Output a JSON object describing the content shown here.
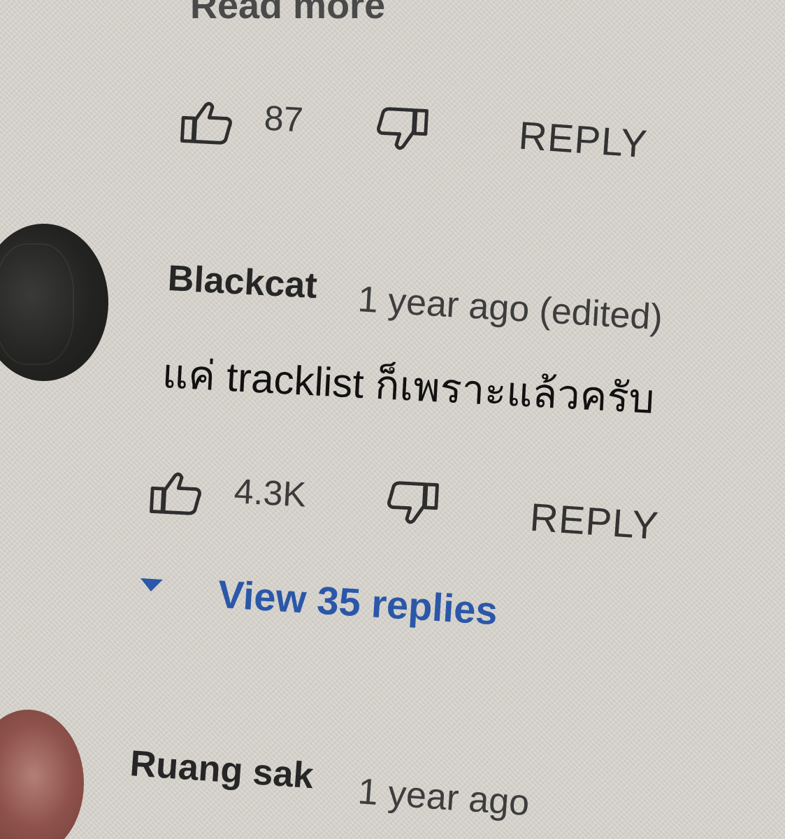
{
  "previous_comment": {
    "read_more_label": "Read more",
    "like_count": "87",
    "reply_label": "REPLY"
  },
  "comments": [
    {
      "author": "Blackcat",
      "time": "1 year ago (edited)",
      "text": "แค่ tracklist ก็เพราะแล้วครับ",
      "like_count": "4.3K",
      "reply_label": "REPLY",
      "view_replies_label": "View 35 replies"
    },
    {
      "author": "Ruang sak",
      "time": "1 year ago"
    }
  ],
  "icons": {
    "like": "thumbs-up-icon",
    "dislike": "thumbs-down-icon",
    "expand": "caret-down-icon"
  },
  "colors": {
    "background": "#d8d4cd",
    "link_blue": "#2a57a8",
    "text": "#262626"
  }
}
